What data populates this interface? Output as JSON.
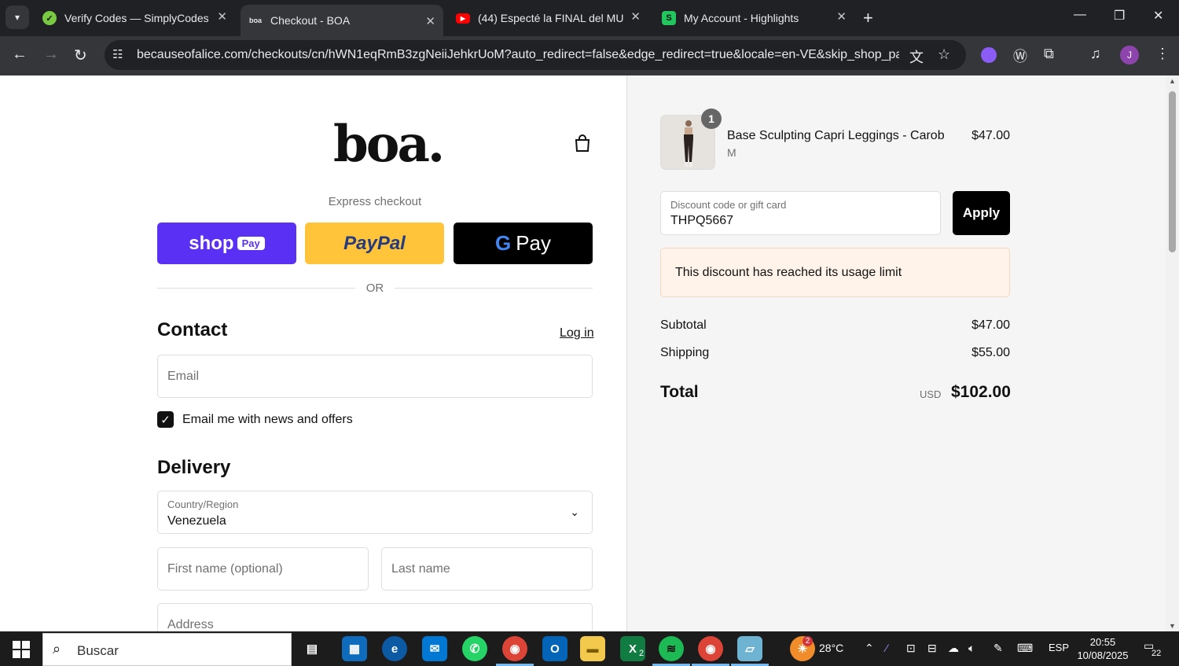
{
  "browser": {
    "tabs": [
      {
        "title": "Verify Codes — SimplyCodes",
        "active": false
      },
      {
        "title": "Checkout - BOA",
        "active": true
      },
      {
        "title": "(44) Especté la FINAL del MUNDIAL",
        "active": false
      },
      {
        "title": "My Account - Highlights",
        "active": false
      }
    ],
    "url": "becauseofalice.com/checkouts/cn/hWN1eqRmB3zgNeiiJehkrUoM?auto_redirect=false&edge_redirect=true&locale=en-VE&skip_shop_pay=t...",
    "profile_initial": "J"
  },
  "checkout": {
    "logo": "boa.",
    "express_label": "Express checkout",
    "shop_pay": {
      "word": "shop",
      "pill": "Pay"
    },
    "paypal": "PayPal",
    "gpay": {
      "g": "G",
      "word": "Pay"
    },
    "or": "OR",
    "contact": {
      "heading": "Contact",
      "login": "Log in",
      "email_placeholder": "Email",
      "newsletter_label": "Email me with news and offers",
      "newsletter_checked": true
    },
    "delivery": {
      "heading": "Delivery",
      "country_label": "Country/Region",
      "country_value": "Venezuela",
      "first_name_placeholder": "First name (optional)",
      "last_name_placeholder": "Last name",
      "address_placeholder": "Address"
    }
  },
  "summary": {
    "product": {
      "name": "Base Sculpting Capri Leggings - Carob",
      "variant": "M",
      "price": "$47.00",
      "quantity": "1"
    },
    "discount": {
      "label": "Discount code or gift card",
      "value": "THPQ5667",
      "apply": "Apply"
    },
    "error": "This discount has reached its usage limit",
    "subtotal_label": "Subtotal",
    "subtotal": "$47.00",
    "shipping_label": "Shipping",
    "shipping": "$55.00",
    "total_label": "Total",
    "currency": "USD",
    "total": "$102.00"
  },
  "taskbar": {
    "search_placeholder": "Buscar",
    "weather": "28°C",
    "language": "ESP",
    "time": "20:55",
    "date": "10/08/2025",
    "weather_badge": "2",
    "excel_badge": "2",
    "notifications": "22"
  },
  "colors": {
    "shop_pay": "#5a31f4",
    "paypal": "#ffc439",
    "error_bg": "#fff3ea"
  }
}
